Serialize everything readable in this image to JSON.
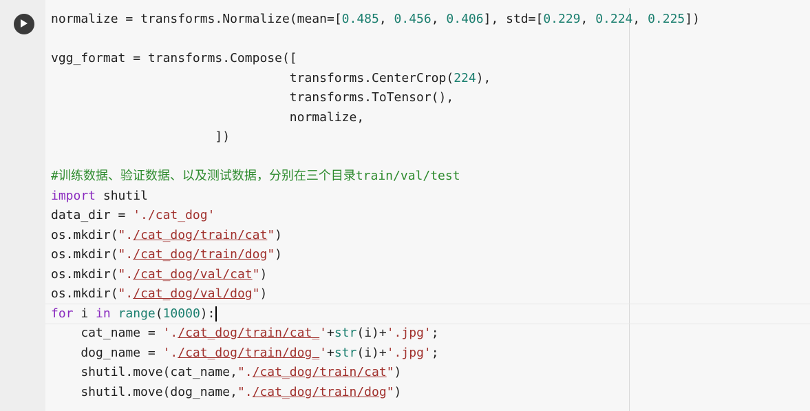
{
  "cell": {
    "run_button_icon": "play-icon",
    "lines": [
      [
        [
          "normalize",
          "plain"
        ],
        [
          " = ",
          "plain"
        ],
        [
          "transforms.Normalize(mean=[",
          "plain"
        ],
        [
          "0.485",
          "num"
        ],
        [
          ", ",
          "plain"
        ],
        [
          "0.456",
          "num"
        ],
        [
          ", ",
          "plain"
        ],
        [
          "0.406",
          "num"
        ],
        [
          "], std=[",
          "plain"
        ],
        [
          "0.229",
          "num"
        ],
        [
          ", ",
          "plain"
        ],
        [
          "0.224",
          "num"
        ],
        [
          ", ",
          "plain"
        ],
        [
          "0.225",
          "num"
        ],
        [
          "])",
          "plain"
        ]
      ],
      [],
      [
        [
          "vgg_format",
          "plain"
        ],
        [
          " = ",
          "plain"
        ],
        [
          "transforms.Compose([",
          "plain"
        ]
      ],
      [
        [
          "                                ",
          "plain"
        ],
        [
          "transforms.CenterCrop(",
          "plain"
        ],
        [
          "224",
          "num"
        ],
        [
          "),",
          "plain"
        ]
      ],
      [
        [
          "                                ",
          "plain"
        ],
        [
          "transforms.ToTensor(),",
          "plain"
        ]
      ],
      [
        [
          "                                ",
          "plain"
        ],
        [
          "normalize,",
          "plain"
        ]
      ],
      [
        [
          "                      ",
          "plain"
        ],
        [
          "])",
          "plain"
        ]
      ],
      [],
      [
        [
          "#训练数据、验证数据、以及测试数据，分别在三个目录train/val/test",
          "cmt"
        ]
      ],
      [
        [
          "import",
          "kw"
        ],
        [
          " shutil",
          "plain"
        ]
      ],
      [
        [
          "data_dir",
          "plain"
        ],
        [
          " = ",
          "plain"
        ],
        [
          "'./cat_dog'",
          "str"
        ]
      ],
      [
        [
          "os.mkdir(",
          "plain"
        ],
        [
          "\".",
          "str"
        ],
        [
          "/cat_dog/train/cat",
          "url"
        ],
        [
          "\"",
          "str"
        ],
        [
          ")",
          "plain"
        ]
      ],
      [
        [
          "os.mkdir(",
          "plain"
        ],
        [
          "\".",
          "str"
        ],
        [
          "/cat_dog/train/dog",
          "url"
        ],
        [
          "\"",
          "str"
        ],
        [
          ")",
          "plain"
        ]
      ],
      [
        [
          "os.mkdir(",
          "plain"
        ],
        [
          "\".",
          "str"
        ],
        [
          "/cat_dog/val/cat",
          "url"
        ],
        [
          "\"",
          "str"
        ],
        [
          ")",
          "plain"
        ]
      ],
      [
        [
          "os.mkdir(",
          "plain"
        ],
        [
          "\".",
          "str"
        ],
        [
          "/cat_dog/val/dog",
          "url"
        ],
        [
          "\"",
          "str"
        ],
        [
          ")",
          "plain"
        ]
      ],
      [
        [
          "for",
          "kw"
        ],
        [
          " i ",
          "plain"
        ],
        [
          "in",
          "kw"
        ],
        [
          " ",
          "plain"
        ],
        [
          "range",
          "bi"
        ],
        [
          "(",
          "plain"
        ],
        [
          "10000",
          "num"
        ],
        [
          "):",
          "plain"
        ],
        [
          "",
          "caret"
        ]
      ],
      [
        [
          "    cat_name",
          "plain"
        ],
        [
          " = ",
          "plain"
        ],
        [
          "'.",
          "str"
        ],
        [
          "/cat_dog/train/cat_",
          "url"
        ],
        [
          "'",
          "str"
        ],
        [
          "+",
          "plain"
        ],
        [
          "str",
          "bi"
        ],
        [
          "(i)+",
          "plain"
        ],
        [
          "'.jpg'",
          "str"
        ],
        [
          ";",
          "plain"
        ]
      ],
      [
        [
          "    dog_name",
          "plain"
        ],
        [
          " = ",
          "plain"
        ],
        [
          "'.",
          "str"
        ],
        [
          "/cat_dog/train/dog_",
          "url"
        ],
        [
          "'",
          "str"
        ],
        [
          "+",
          "plain"
        ],
        [
          "str",
          "bi"
        ],
        [
          "(i)+",
          "plain"
        ],
        [
          "'.jpg'",
          "str"
        ],
        [
          ";",
          "plain"
        ]
      ],
      [
        [
          "    shutil.move(cat_name,",
          "plain"
        ],
        [
          "\".",
          "str"
        ],
        [
          "/cat_dog/train/cat",
          "url"
        ],
        [
          "\"",
          "str"
        ],
        [
          ")",
          "plain"
        ]
      ],
      [
        [
          "    shutil.move(dog_name,",
          "plain"
        ],
        [
          "\".",
          "str"
        ],
        [
          "/cat_dog/train/dog",
          "url"
        ],
        [
          "\"",
          "str"
        ],
        [
          ")",
          "plain"
        ]
      ]
    ]
  }
}
